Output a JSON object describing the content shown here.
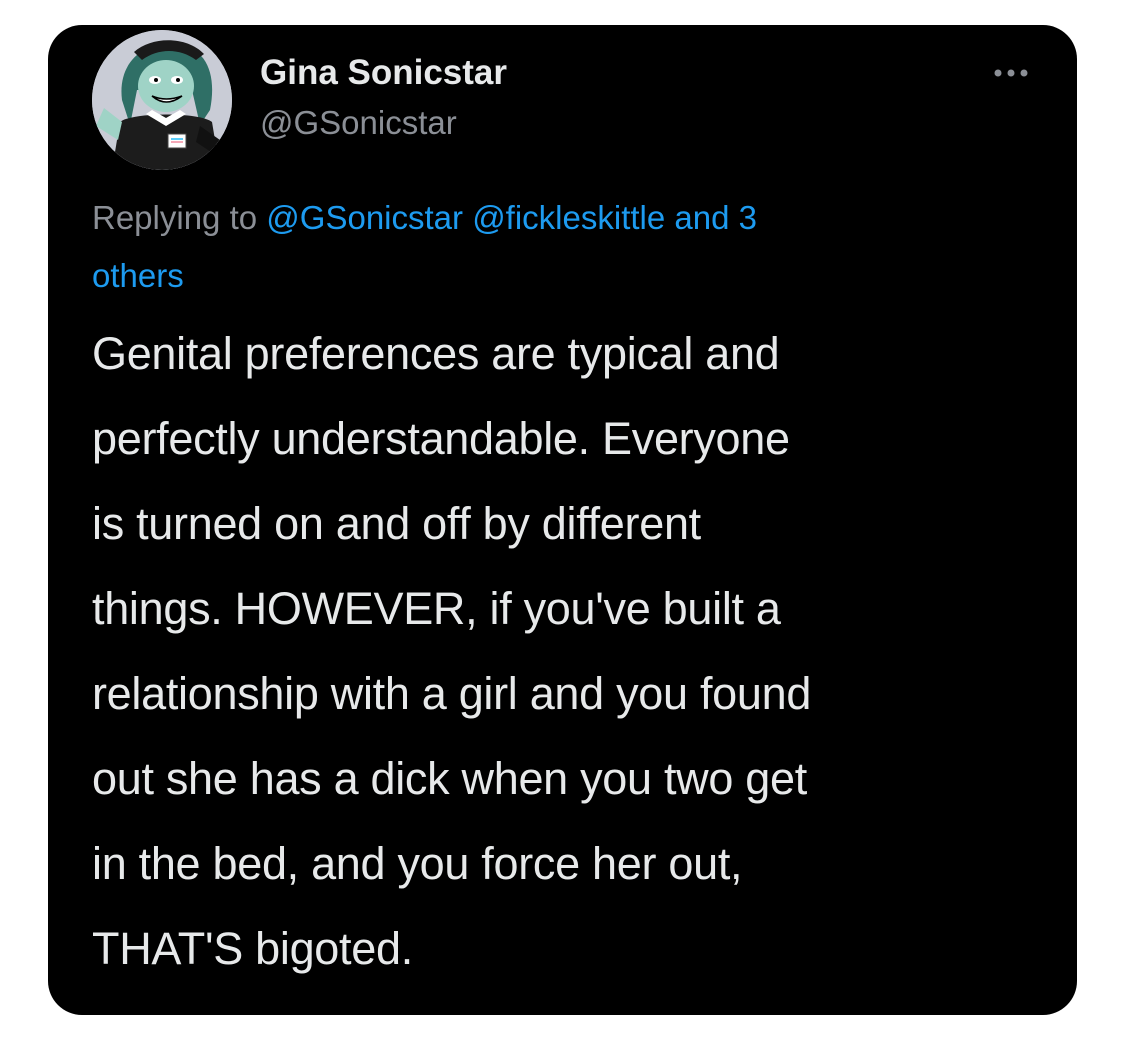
{
  "tweet": {
    "author_name": "Gina Sonicstar",
    "author_handle": "@GSonicstar",
    "more_icon": "more-horizontal-icon",
    "reply_prefix": "Replying to",
    "reply_mentions": [
      "@GSonicstar",
      "@fickleskittle"
    ],
    "reply_others_line1": "and 3",
    "reply_others_line2": "others",
    "body_lines": [
      "Genital preferences are typical and",
      "perfectly understandable. Everyone",
      "is turned on and off by different",
      "things. HOWEVER, if you've built a",
      "relationship with a girl and you found",
      "out she has a dick when you two get",
      "in the bed, and you force her out,",
      "THAT'S bigoted."
    ]
  },
  "colors": {
    "card_background": "#000000",
    "page_background": "#ffffff",
    "link": "#1d9bf0",
    "text_primary": "#e7e9ea",
    "text_secondary": "#8b8f96"
  }
}
